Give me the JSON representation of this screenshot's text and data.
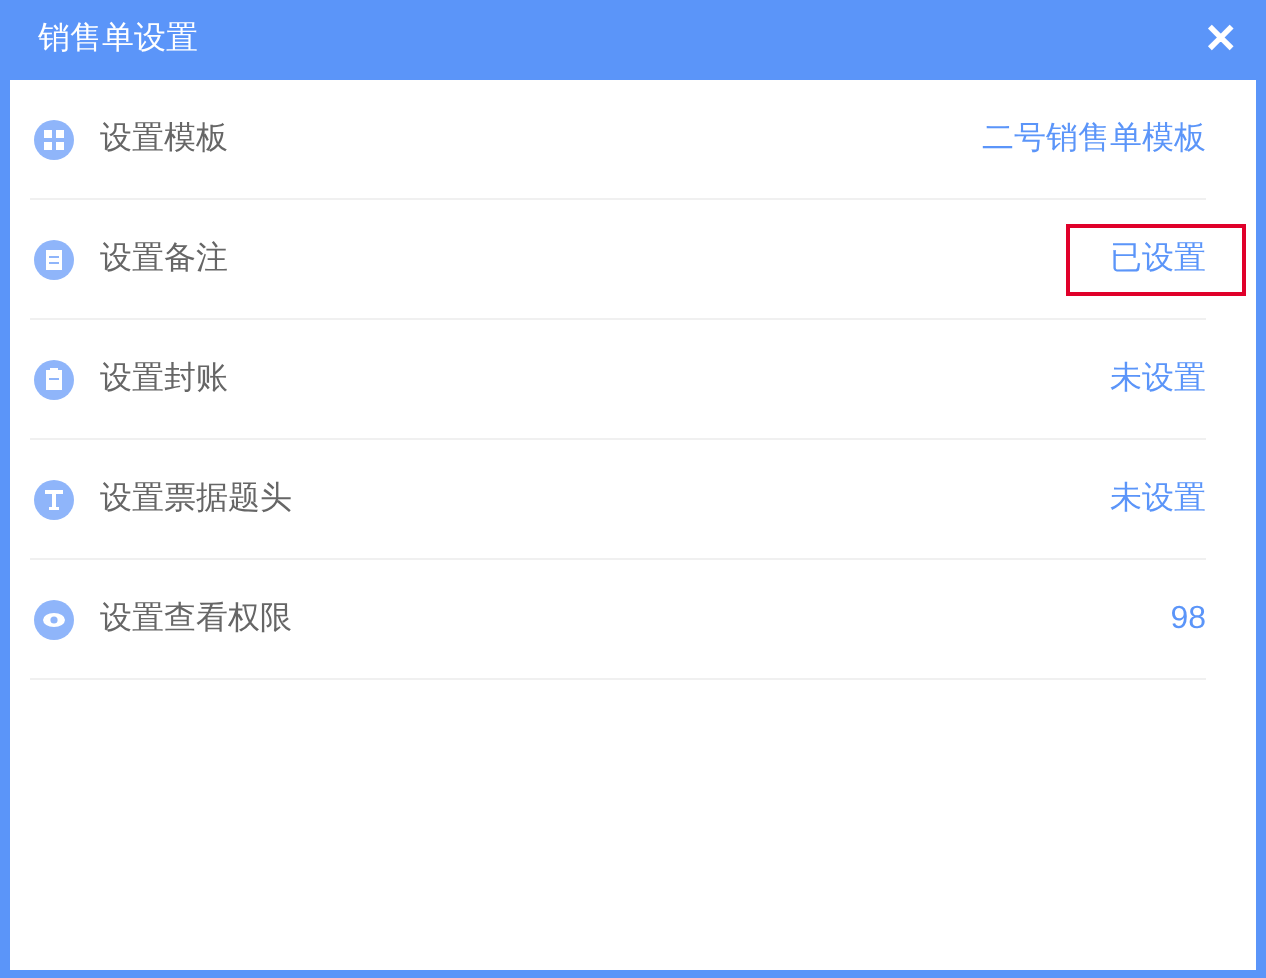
{
  "window": {
    "title": "销售单设置",
    "close": "✕"
  },
  "rows": [
    {
      "kind": "grid",
      "label": "设置模板",
      "value": "二号销售单模板",
      "highlighted": false
    },
    {
      "kind": "document",
      "label": "设置备注",
      "value": "已设置",
      "highlighted": true
    },
    {
      "kind": "clipboard",
      "label": "设置封账",
      "value": "未设置",
      "highlighted": false
    },
    {
      "kind": "letter",
      "label": "设置票据题头",
      "value": "未设置",
      "highlighted": false
    },
    {
      "kind": "eye",
      "label": "设置查看权限",
      "value": "98",
      "highlighted": false
    }
  ]
}
